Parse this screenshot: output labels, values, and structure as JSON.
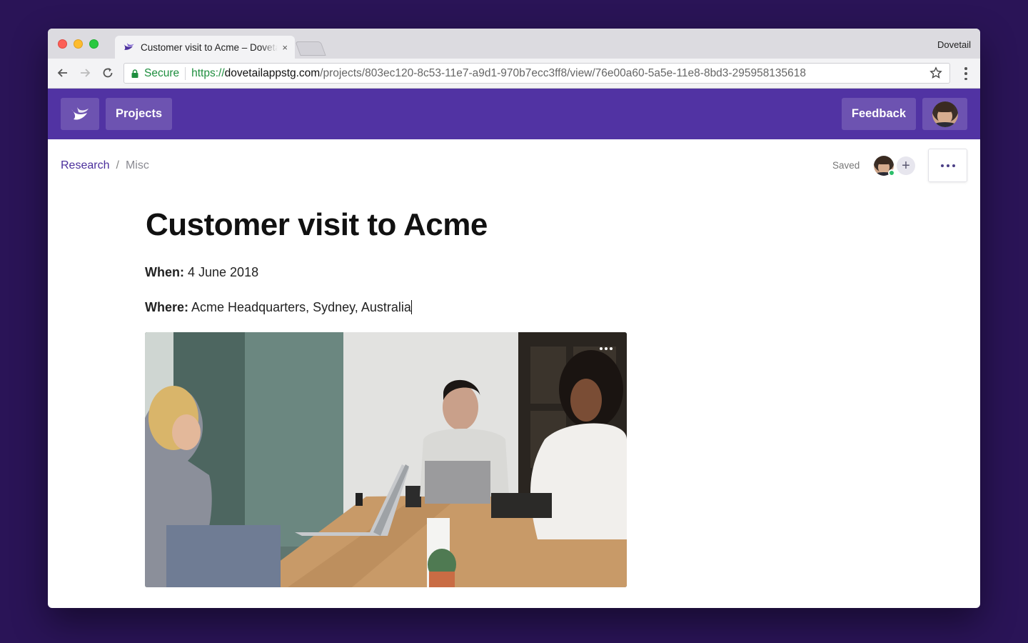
{
  "browser": {
    "tab_title": "Customer visit to Acme – Dovetail",
    "tab_close": "×",
    "profile_name": "Dovetail",
    "secure_label": "Secure",
    "url_scheme": "https://",
    "url_host": "dovetailappstg.com",
    "url_path": "/projects/803ec120-8c53-11e7-a9d1-970b7ecc3ff8/view/76e00a60-5a5e-11e8-8bd3-295958135618"
  },
  "app_header": {
    "projects_label": "Projects",
    "feedback_label": "Feedback"
  },
  "doc_header": {
    "breadcrumb": {
      "parent": "Research",
      "separator": "/",
      "current": "Misc"
    },
    "status": "Saved",
    "add_label": "+"
  },
  "document": {
    "title": "Customer visit to Acme",
    "when_label": "When:",
    "when_value": "4 June 2018",
    "where_label": "Where:",
    "where_value": "Acme Headquarters, Sydney, Australia"
  },
  "colors": {
    "brand_purple": "#5133a3",
    "page_background": "#2a1457",
    "link_purple": "#4b2f9c",
    "secure_green": "#1e8e3e",
    "online_green": "#2dbf6b"
  },
  "icons": {
    "logo": "dovetail-logo-icon",
    "lock": "lock-icon",
    "star": "bookmark-star-icon",
    "more": "more-horizontal-icon"
  }
}
